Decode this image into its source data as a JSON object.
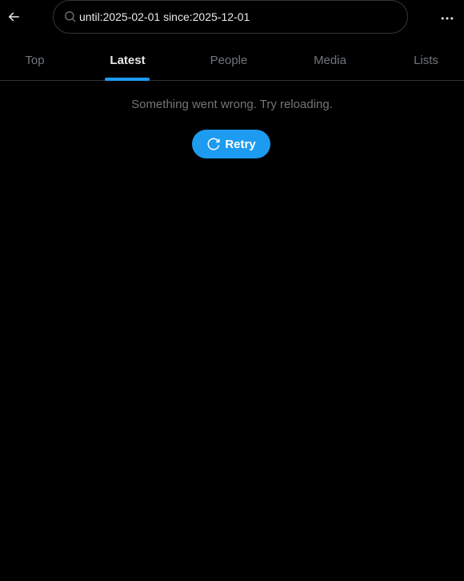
{
  "search": {
    "query": "until:2025-02-01 since:2025-12-01"
  },
  "tabs": [
    {
      "label": "Top",
      "active": false
    },
    {
      "label": "Latest",
      "active": true
    },
    {
      "label": "People",
      "active": false
    },
    {
      "label": "Media",
      "active": false
    },
    {
      "label": "Lists",
      "active": false
    }
  ],
  "error": {
    "message": "Something went wrong. Try reloading.",
    "retry_label": "Retry"
  },
  "icons": {
    "back": "arrow-left-icon",
    "search": "search-icon",
    "more": "more-horizontal-icon",
    "retry": "refresh-icon"
  },
  "colors": {
    "background": "#000000",
    "accent": "#1d9bf0",
    "text_primary": "#e7e9ea",
    "text_secondary": "#71767b",
    "border": "#2f3336"
  }
}
